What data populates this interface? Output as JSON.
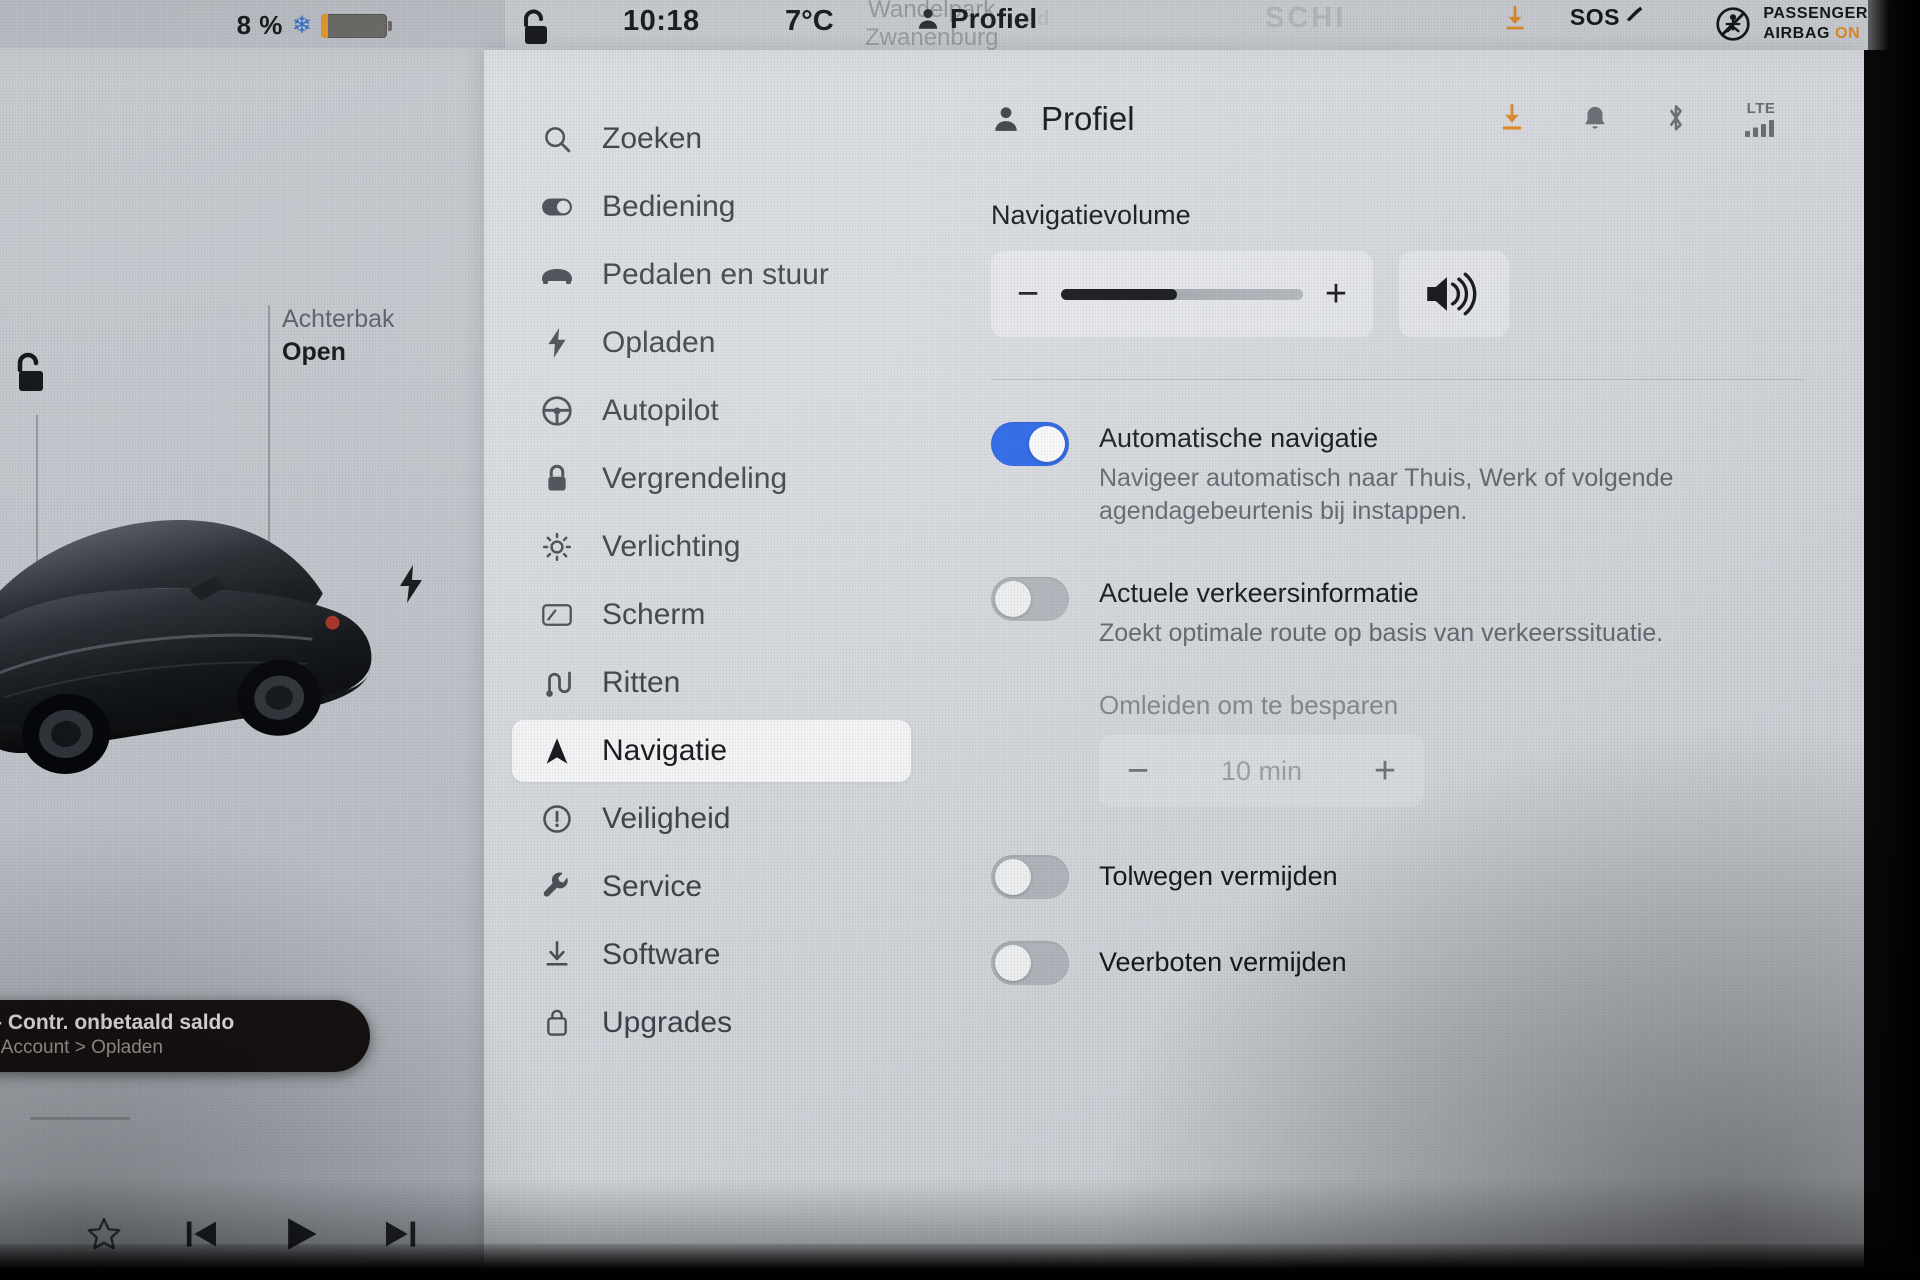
{
  "status_bar": {
    "battery_percent": "8 %",
    "battery_cold_icon": "snowflake-icon",
    "lock_icon": "unlocked-padlock-icon",
    "clock": "10:18",
    "temperature": "7°C",
    "profile_name": "Profiel",
    "download_icon": "download-arrow-icon",
    "sos_label": "SOS",
    "airbag_line1": "PASSENGER",
    "airbag_line2": "AIRBAG",
    "airbag_state": "ON"
  },
  "map_background": {
    "place_line1": "Wandelpark",
    "place_line2": "Zwanenburg",
    "street_ghost": "SCHI",
    "street_ghost2": "ad"
  },
  "left_panel": {
    "lock_icon": "unlocked-padlock-icon",
    "trunk_label": "Achterbak",
    "trunk_state": "Open",
    "charge_icon": "charging-bolt-icon",
    "notification": {
      "line1": "mog. - Contr. onbetaald saldo",
      "line2": "rofiel > Account > Opladen"
    },
    "media_controls": [
      {
        "name": "favorite-star-icon",
        "glyph": "star"
      },
      {
        "name": "previous-track-icon",
        "glyph": "prev"
      },
      {
        "name": "play-icon",
        "glyph": "play"
      },
      {
        "name": "next-track-icon",
        "glyph": "next"
      }
    ]
  },
  "sidebar": {
    "items": [
      {
        "label": "Zoeken",
        "icon": "search-icon",
        "active": false
      },
      {
        "label": "Bediening",
        "icon": "toggle-switch-icon",
        "active": false
      },
      {
        "label": "Pedalen en stuur",
        "icon": "car-front-icon",
        "active": false
      },
      {
        "label": "Opladen",
        "icon": "bolt-icon",
        "active": false
      },
      {
        "label": "Autopilot",
        "icon": "steering-wheel-icon",
        "active": false
      },
      {
        "label": "Vergrendeling",
        "icon": "lock-icon",
        "active": false
      },
      {
        "label": "Verlichting",
        "icon": "light-bulb-icon",
        "active": false
      },
      {
        "label": "Scherm",
        "icon": "display-icon",
        "active": false
      },
      {
        "label": "Ritten",
        "icon": "trips-route-icon",
        "active": false
      },
      {
        "label": "Navigatie",
        "icon": "navigation-arrow-icon",
        "active": true
      },
      {
        "label": "Veiligheid",
        "icon": "exclamation-circle-icon",
        "active": false
      },
      {
        "label": "Service",
        "icon": "wrench-icon",
        "active": false
      },
      {
        "label": "Software",
        "icon": "download-icon",
        "active": false
      },
      {
        "label": "Upgrades",
        "icon": "shopping-bag-icon",
        "active": false
      }
    ]
  },
  "content": {
    "title": "Profiel",
    "title_icon": "person-icon",
    "header_icons": [
      {
        "name": "download-icon",
        "color": "#e08c2a"
      },
      {
        "name": "bell-icon",
        "color": "#6b6f76"
      },
      {
        "name": "bluetooth-icon",
        "color": "#6b6f76"
      }
    ],
    "connectivity": {
      "label": "LTE",
      "icon": "signal-bars-icon",
      "bars": 4
    },
    "volume": {
      "label": "Navigatievolume",
      "minus_label": "−",
      "plus_label": "+",
      "fill_percent": 48,
      "speaker_icon": "speaker-waves-icon"
    },
    "settings": [
      {
        "name": "automatische-navigatie",
        "title": "Automatische navigatie",
        "description": "Navigeer automatisch naar Thuis, Werk of volgende agendagebeurtenis bij instappen.",
        "state": "on"
      },
      {
        "name": "actuele-verkeersinformatie",
        "title": "Actuele verkeersinformatie",
        "description": "Zoekt optimale route op basis van verkeerssituatie.",
        "state": "off"
      }
    ],
    "detour": {
      "label": "Omleiden om te besparen",
      "value": "10 min",
      "minus_label": "−",
      "plus_label": "+",
      "disabled": true
    },
    "avoid_settings": [
      {
        "name": "tolwegen-vermijden",
        "title": "Tolwegen vermijden",
        "state": "off"
      },
      {
        "name": "veerboten-vermijden",
        "title": "Veerboten vermijden",
        "state": "off"
      }
    ]
  },
  "colors": {
    "accent_blue": "#2663e8",
    "accent_orange": "#e08c2a",
    "panel_bg": "#d6d9de",
    "text_primary": "#15171a",
    "text_secondary": "#62666d"
  }
}
